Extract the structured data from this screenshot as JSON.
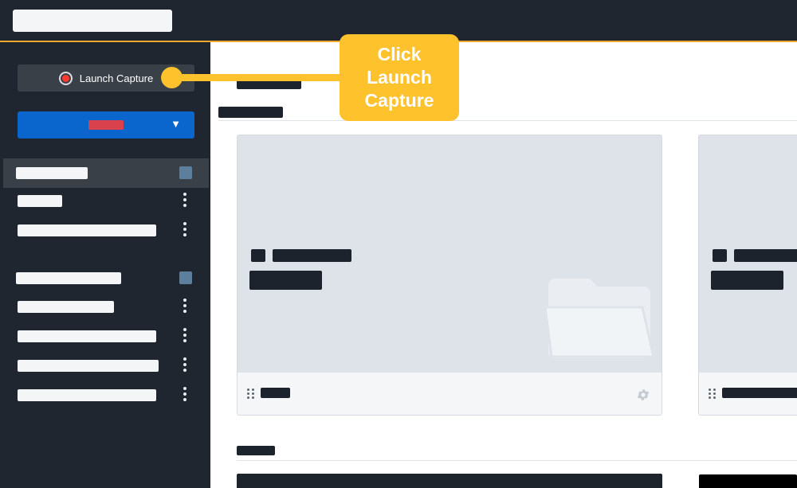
{
  "sidebar": {
    "launch_button": {
      "label": "Launch Capture",
      "icon": "record-icon"
    },
    "dropdown": {
      "icon": "caret-down-icon",
      "caret": "▼"
    },
    "sections": [
      {
        "badge": true
      },
      {
        "badge": true
      }
    ]
  },
  "callout": {
    "text": "Click Launch Capture",
    "color": "#fdc22c"
  },
  "colors": {
    "topbar": "#20262f",
    "topbar_accent": "#f0a830",
    "sidebar": "#20262f",
    "sidebar_active": "#3a4048",
    "dropdown": "#0a66cc",
    "badge": "#5d7f9e",
    "card_thumb": "#dee2e9"
  },
  "main": {
    "cards": [
      {
        "thumbnail_icon": "folder-icon",
        "footer_icon": "gear-icon"
      },
      {
        "thumbnail_icon": "folder-icon"
      }
    ]
  }
}
